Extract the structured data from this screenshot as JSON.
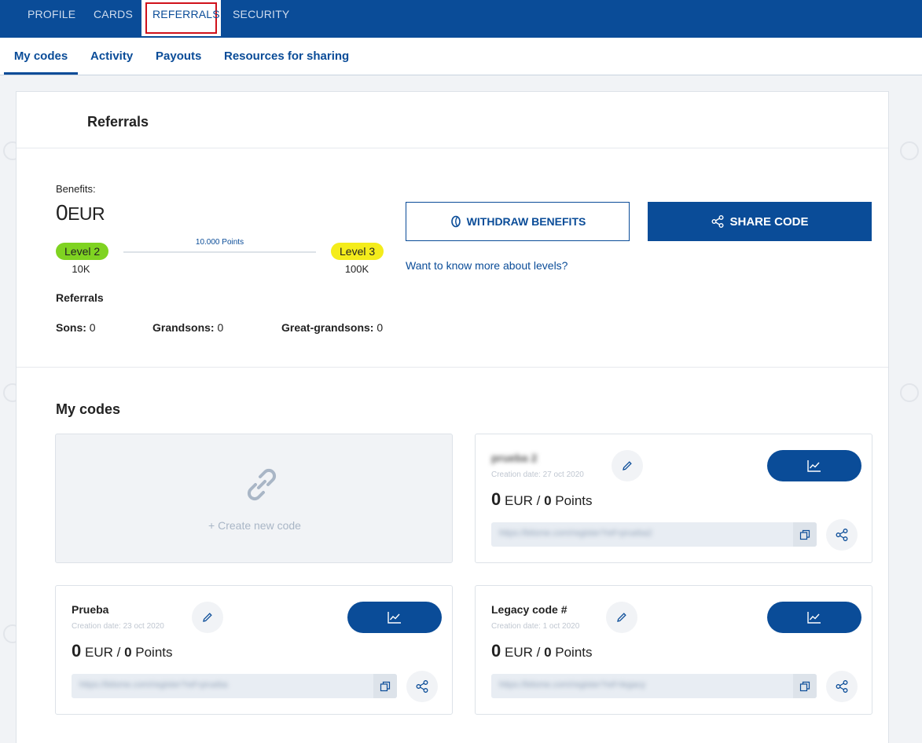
{
  "top_nav": {
    "tabs": [
      {
        "label": "PROFILE"
      },
      {
        "label": "CARDS"
      },
      {
        "label": "REFERRALS"
      },
      {
        "label": "SECURITY"
      }
    ],
    "active_tab": "REFERRALS"
  },
  "sub_nav": {
    "tabs": [
      {
        "label": "My codes"
      },
      {
        "label": "Activity"
      },
      {
        "label": "Payouts"
      },
      {
        "label": "Resources for sharing"
      }
    ],
    "active_tab": "My codes"
  },
  "panel": {
    "title": "Referrals",
    "benefits": {
      "label": "Benefits:",
      "amount": "0",
      "currency": "EUR"
    },
    "levels": {
      "current": {
        "label": "Level 2",
        "points": "10K",
        "color": "#7fd321"
      },
      "next": {
        "label": "Level 3",
        "points": "100K",
        "color": "#f4ec1b"
      },
      "progress_label": "10.000 Points"
    },
    "referrals": {
      "heading": "Referrals",
      "sons_label": "Sons:",
      "sons_value": "0",
      "grandsons_label": "Grandsons:",
      "grandsons_value": "0",
      "great_grandsons_label": "Great-grandsons:",
      "great_grandsons_value": "0"
    },
    "withdraw_button": "WITHDRAW BENEFITS",
    "share_button": "SHARE CODE",
    "levels_link": "Want to know more about levels?"
  },
  "my_codes": {
    "heading": "My codes",
    "create_label": "+  Create new code",
    "codes": [
      {
        "name": "prueba 2",
        "creation_date": "Creation date: 27 oct 2020",
        "eur": "0",
        "eur_label": "EUR /",
        "points": "0",
        "points_label": "Points",
        "url": "https://bitsme.com/register?ref=prueba2"
      },
      {
        "name": "Prueba",
        "creation_date": "Creation date: 23 oct 2020",
        "eur": "0",
        "eur_label": "EUR /",
        "points": "0",
        "points_label": "Points",
        "url": "https://bitsme.com/register?ref=prueba"
      },
      {
        "name": "Legacy code #",
        "creation_date": "Creation date: 1 oct 2020",
        "eur": "0",
        "eur_label": "EUR /",
        "points": "0",
        "points_label": "Points",
        "url": "https://bitsme.com/register?ref=legacy"
      }
    ]
  },
  "colors": {
    "brand": "#0a4c98",
    "level2": "#7fd321",
    "level3": "#f4ec1b",
    "highlight": "#d0121b"
  }
}
